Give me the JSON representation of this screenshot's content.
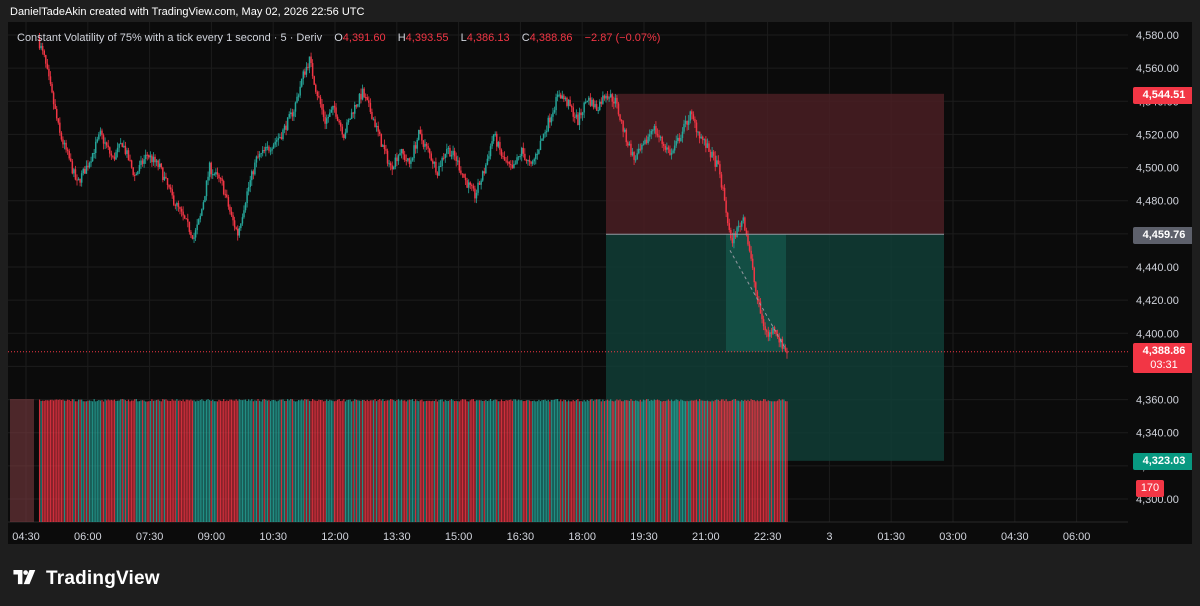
{
  "credit": "DanielTadeAkin created with TradingView.com, May 02, 2026 22:56 UTC",
  "legend": {
    "symbol": "Constant Volatility of 75% with a tick every 1 second · 5 · Deriv",
    "open_label": "O",
    "open": "4,391.60",
    "high_label": "H",
    "high": "4,393.55",
    "low_label": "L",
    "low": "4,386.13",
    "close_label": "C",
    "close": "4,388.86",
    "change": "−2.87 (−0.07%)"
  },
  "price_axis": {
    "ticks": [
      "4,580.00",
      "4,560.00",
      "4,540.00",
      "4,520.00",
      "4,500.00",
      "4,480.00",
      "4,460.00",
      "4,440.00",
      "4,420.00",
      "4,400.00",
      "4,380.00",
      "4,360.00",
      "4,340.00",
      "4,320.00",
      "4,300.00"
    ],
    "stop_label": "4,544.51",
    "entry_label": "4,459.76",
    "current_label": "4,388.86",
    "countdown": "03:31",
    "target_label": "4,323.03",
    "volume_label": "170"
  },
  "time_axis": [
    "04:30",
    "06:00",
    "07:30",
    "09:00",
    "10:30",
    "12:00",
    "13:30",
    "15:00",
    "16:30",
    "18:00",
    "19:30",
    "21:00",
    "22:30",
    "3",
    "01:30",
    "03:00",
    "04:30",
    "06:00"
  ],
  "position": {
    "type": "short",
    "entry": 4459.76,
    "stop": 4544.51,
    "target": 4323.03
  },
  "colors": {
    "up": "#26a69a",
    "down": "#f23645",
    "stop_zone": "#4a1f23",
    "target_zone": "#103d36",
    "entry_tag": "#5d606b",
    "target_tag": "#089981"
  },
  "brand": "TradingView"
}
